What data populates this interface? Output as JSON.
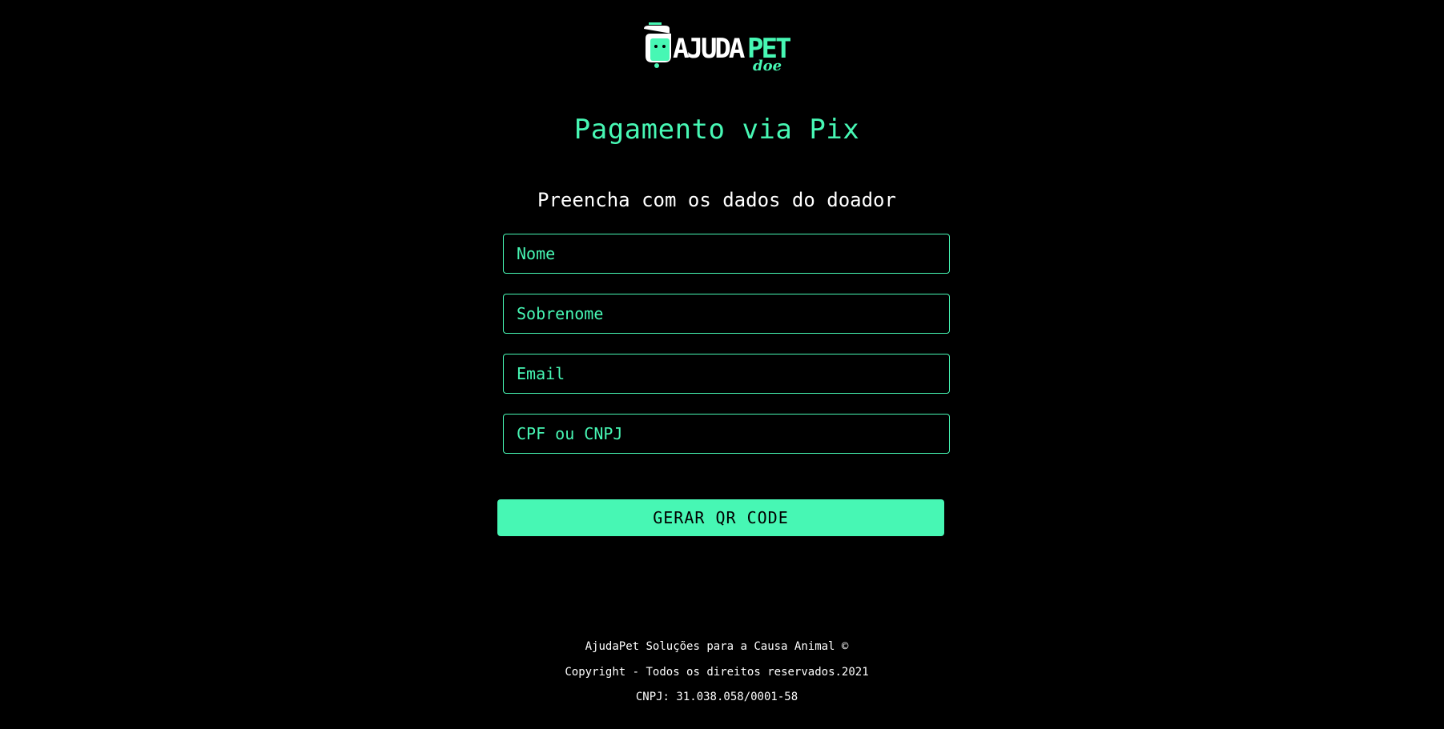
{
  "brand": {
    "logo_text": "AJUDAPET",
    "logo_tagline": "doe",
    "accent_color": "#47f7b4",
    "background_color": "#000000"
  },
  "page": {
    "title": "Pagamento via Pix",
    "subtitle": "Preencha com os dados do doador"
  },
  "form": {
    "fields": [
      {
        "placeholder": "Nome",
        "value": ""
      },
      {
        "placeholder": "Sobrenome",
        "value": ""
      },
      {
        "placeholder": "Email",
        "value": ""
      },
      {
        "placeholder": "CPF ou CNPJ",
        "value": ""
      }
    ],
    "submit_label": "GERAR QR CODE"
  },
  "footer": {
    "line1": "AjudaPet Soluções para a Causa Animal ©",
    "line2": "Copyright - Todos os direitos reservados.2021",
    "line3": "CNPJ: 31.038.058/0001-58"
  }
}
